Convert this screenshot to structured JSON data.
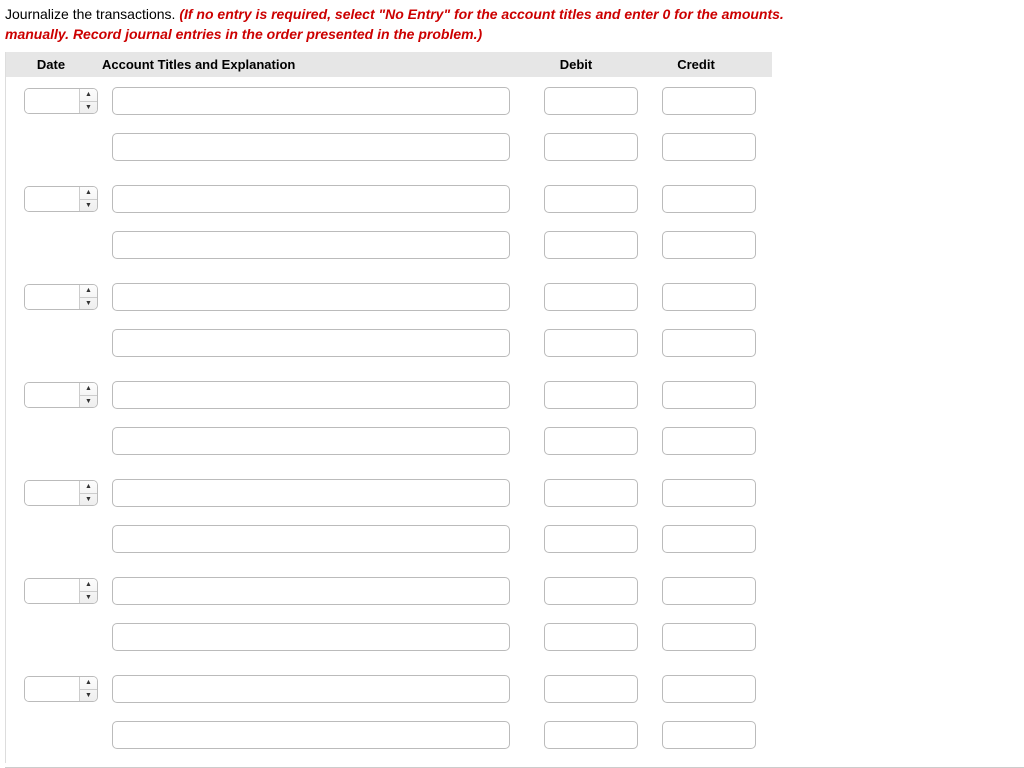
{
  "instruction": {
    "lead": "Journalize the transactions.",
    "emph_line1": " (If no entry is required, select \"No Entry\" for the account titles and enter 0 for the amounts.",
    "emph_line2": "manually. Record journal entries in the order presented in the problem.)"
  },
  "headers": {
    "date": "Date",
    "account": "Account Titles and Explanation",
    "debit": "Debit",
    "credit": "Credit"
  },
  "entries": [
    {
      "date": "",
      "line1": {
        "account": "",
        "debit": "",
        "credit": ""
      },
      "line2": {
        "account": "",
        "debit": "",
        "credit": ""
      }
    },
    {
      "date": "",
      "line1": {
        "account": "",
        "debit": "",
        "credit": ""
      },
      "line2": {
        "account": "",
        "debit": "",
        "credit": ""
      }
    },
    {
      "date": "",
      "line1": {
        "account": "",
        "debit": "",
        "credit": ""
      },
      "line2": {
        "account": "",
        "debit": "",
        "credit": ""
      }
    },
    {
      "date": "",
      "line1": {
        "account": "",
        "debit": "",
        "credit": ""
      },
      "line2": {
        "account": "",
        "debit": "",
        "credit": ""
      }
    },
    {
      "date": "",
      "line1": {
        "account": "",
        "debit": "",
        "credit": ""
      },
      "line2": {
        "account": "",
        "debit": "",
        "credit": ""
      }
    },
    {
      "date": "",
      "line1": {
        "account": "",
        "debit": "",
        "credit": ""
      },
      "line2": {
        "account": "",
        "debit": "",
        "credit": ""
      }
    },
    {
      "date": "",
      "line1": {
        "account": "",
        "debit": "",
        "credit": ""
      },
      "line2": {
        "account": "",
        "debit": "",
        "credit": ""
      }
    }
  ]
}
